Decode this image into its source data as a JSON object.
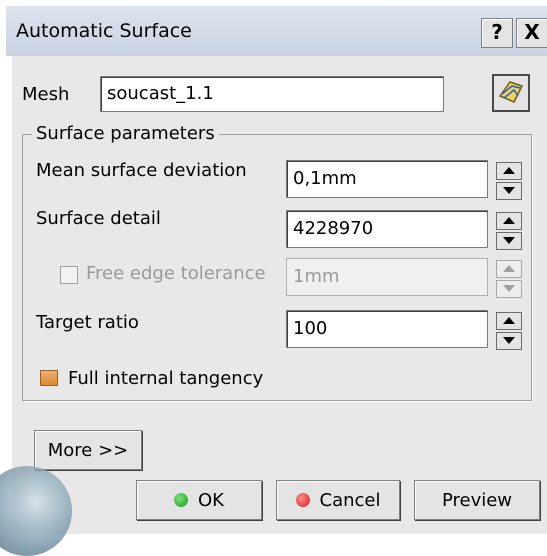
{
  "window": {
    "title": "Automatic Surface",
    "help_label": "?",
    "close_label": "X"
  },
  "mesh": {
    "label": "Mesh",
    "value": "soucast_1.1",
    "select_icon": "mesh-select-icon"
  },
  "surface_parameters": {
    "group_label": "Surface parameters",
    "mean_deviation": {
      "label": "Mean surface deviation",
      "value": "0,1mm"
    },
    "surface_detail": {
      "label": "Surface detail",
      "value": "4228970"
    },
    "free_edge": {
      "label": "Free edge tolerance",
      "value": "1mm",
      "checked": false,
      "enabled": false
    },
    "target_ratio": {
      "label": "Target ratio",
      "value": "100"
    },
    "full_tangency": {
      "label": "Full internal tangency",
      "checked": true
    }
  },
  "buttons": {
    "more": "More >>",
    "ok": "OK",
    "cancel": "Cancel",
    "preview": "Preview"
  },
  "colors": {
    "ok_dot": "#1f9a1f",
    "cancel_dot": "#d42020"
  }
}
